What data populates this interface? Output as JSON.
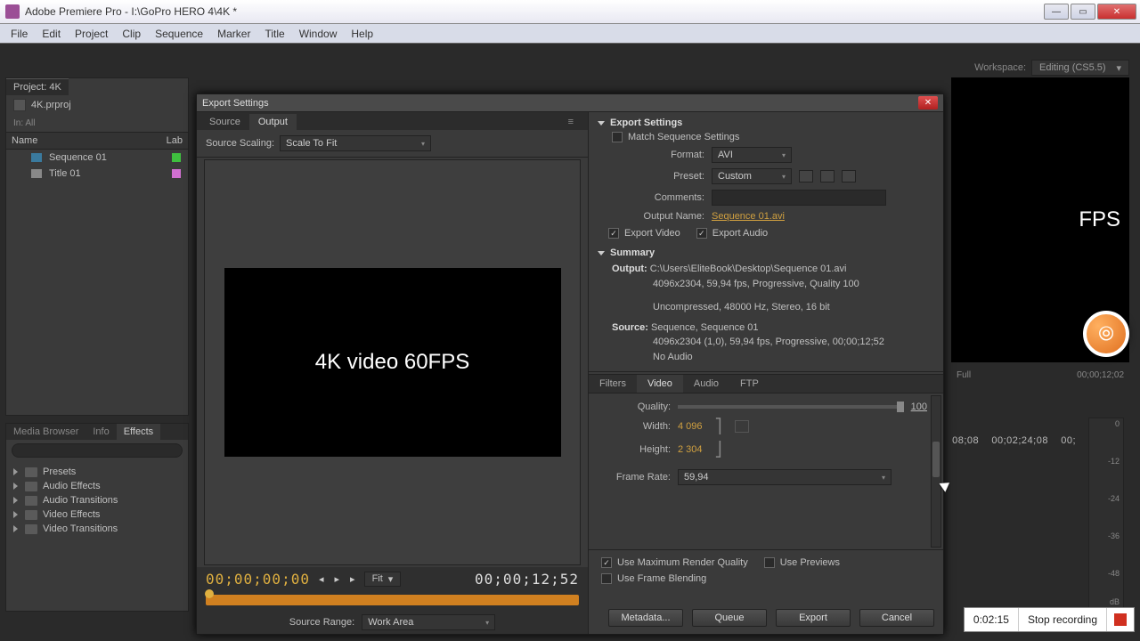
{
  "window": {
    "title": "Adobe Premiere Pro - I:\\GoPro HERO 4\\4K *",
    "minimize": "—",
    "maximize": "▭",
    "close": "✕"
  },
  "menu": {
    "items": [
      "File",
      "Edit",
      "Project",
      "Clip",
      "Sequence",
      "Marker",
      "Title",
      "Window",
      "Help"
    ]
  },
  "workspace": {
    "label": "Workspace:",
    "value": "Editing (CS5.5)"
  },
  "project": {
    "tab": "Project: 4K",
    "file": "4K.prproj",
    "in_label": "In:",
    "in_value": "All",
    "col_name": "Name",
    "col_label": "Lab",
    "items": [
      {
        "name": "Sequence 01",
        "color": "#3fbf3f"
      },
      {
        "name": "Title 01",
        "color": "#d070d0"
      }
    ]
  },
  "effects": {
    "tabs": [
      "Media Browser",
      "Info",
      "Effects"
    ],
    "active": 2,
    "items": [
      "Presets",
      "Audio Effects",
      "Audio Transitions",
      "Video Effects",
      "Video Transitions"
    ]
  },
  "right_preview": {
    "text_fragment": "FPS",
    "tc": "00;00;12;02",
    "fit": "Full"
  },
  "timeline": {
    "t1": "08;08",
    "t2": "00;02;24;08",
    "t3": "00;"
  },
  "meter_marks": [
    "0",
    "-12",
    "-24",
    "-36",
    "-48",
    "dB"
  ],
  "dialog": {
    "title": "Export Settings",
    "close": "✕",
    "src_tabs": [
      "Source",
      "Output"
    ],
    "scaling_label": "Source Scaling:",
    "scaling_value": "Scale To Fit",
    "preview_text": "4K video 60FPS",
    "tc_start": "00;00;00;00",
    "tc_end": "00;00;12;52",
    "fit": "Fit",
    "source_range_label": "Source Range:",
    "source_range_value": "Work Area",
    "sect_export": "Export Settings",
    "match_seq": "Match Sequence Settings",
    "format_label": "Format:",
    "format_value": "AVI",
    "preset_label": "Preset:",
    "preset_value": "Custom",
    "comments_label": "Comments:",
    "output_name_label": "Output Name:",
    "output_name_value": "Sequence 01.avi",
    "export_video": "Export Video",
    "export_audio": "Export Audio",
    "summary_head": "Summary",
    "summary_output_k": "Output:",
    "summary_output_1": "C:\\Users\\EliteBook\\Desktop\\Sequence 01.avi",
    "summary_output_2": "4096x2304, 59,94 fps, Progressive, Quality 100",
    "summary_output_3": "Uncompressed, 48000 Hz, Stereo, 16 bit",
    "summary_source_k": "Source:",
    "summary_source_1": "Sequence, Sequence 01",
    "summary_source_2": "4096x2304 (1,0), 59,94 fps, Progressive, 00;00;12;52",
    "summary_source_3": "No Audio",
    "vid_tabs": [
      "Filters",
      "Video",
      "Audio",
      "FTP"
    ],
    "quality_label": "Quality:",
    "quality_value": "100",
    "width_label": "Width:",
    "width_value": "4 096",
    "height_label": "Height:",
    "height_value": "2 304",
    "fps_label": "Frame Rate:",
    "fps_value": "59,94",
    "use_max": "Use Maximum Render Quality",
    "use_prev": "Use Previews",
    "use_blend": "Use Frame Blending",
    "btn_meta": "Metadata...",
    "btn_queue": "Queue",
    "btn_export": "Export",
    "btn_cancel": "Cancel"
  },
  "recorder": {
    "time": "0:02:15",
    "label": "Stop recording"
  }
}
